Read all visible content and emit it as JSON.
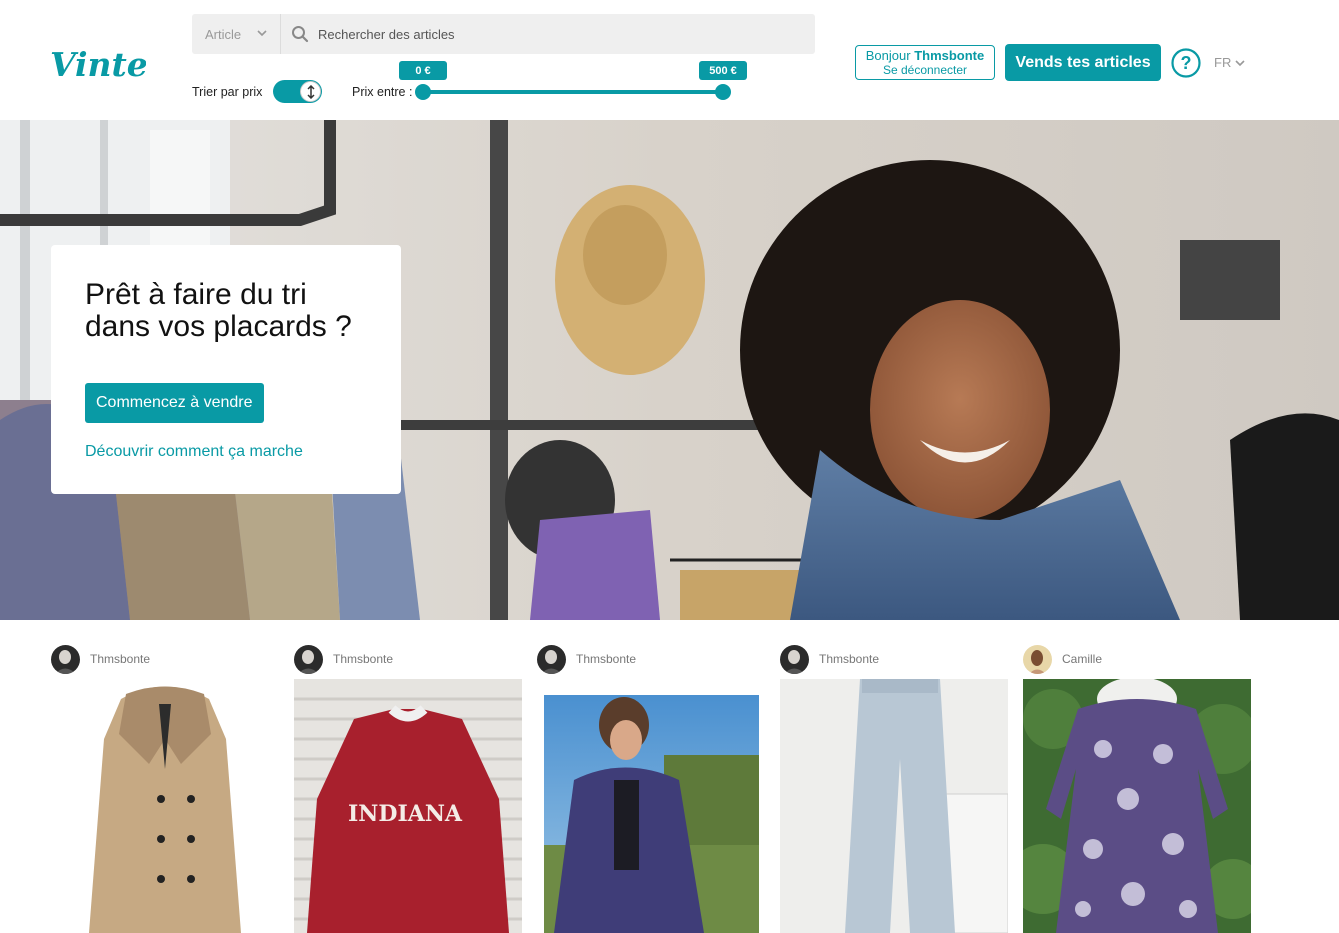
{
  "header": {
    "logo_text": "Vinted",
    "category_select": "Article",
    "search_placeholder": "Rechercher des articles",
    "sort_label": "Trier par prix",
    "price_label": "Prix entre :",
    "price_min": "0 €",
    "price_max": "500 €",
    "account_greeting": "Bonjour",
    "account_username": "Thmsbonte",
    "logout_label": "Se déconnecter",
    "sell_button": "Vends tes articles",
    "help_icon": "question-circle-icon",
    "language": "FR"
  },
  "hero": {
    "title": "Prêt à faire du tri dans vos placards ?",
    "cta_button": "Commencez à vendre",
    "how_it_works_link": "Découvrir comment ça marche"
  },
  "feed": {
    "items": [
      {
        "seller": "Thmsbonte",
        "photo": "beige-coat"
      },
      {
        "seller": "Thmsbonte",
        "photo": "red-indiana-sweatshirt",
        "print": "INDIANA"
      },
      {
        "seller": "Thmsbonte",
        "photo": "navy-shirt"
      },
      {
        "seller": "Thmsbonte",
        "photo": "light-blue-pants"
      },
      {
        "seller": "Camille",
        "photo": "purple-print-dress"
      }
    ]
  },
  "colors": {
    "brand": "#099aa5",
    "search_bg": "#efefef"
  }
}
